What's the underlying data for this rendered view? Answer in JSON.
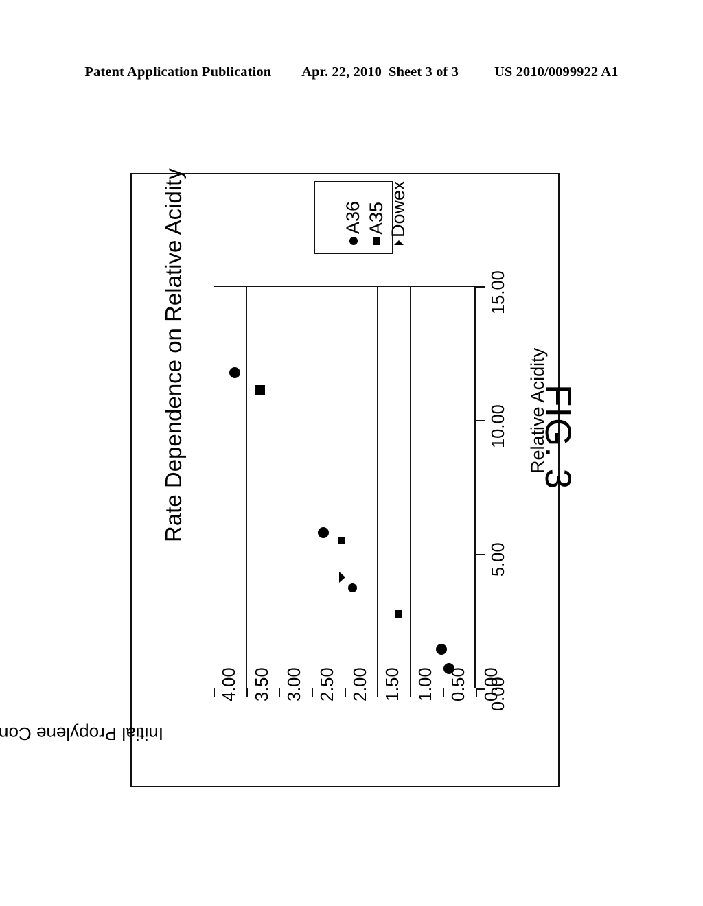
{
  "header": {
    "publication": "Patent Application Publication",
    "date": "Apr. 22, 2010",
    "sheet": "Sheet 3 of 3",
    "doc_number": "US 2010/0099922 A1"
  },
  "figure": {
    "caption": "FIG. 3"
  },
  "legend": {
    "items": [
      {
        "label": "A36",
        "marker": "circle"
      },
      {
        "label": "A35",
        "marker": "square"
      },
      {
        "label": "Dowex",
        "marker": "triangle"
      }
    ]
  },
  "chart_data": {
    "type": "scatter",
    "title": "Rate Dependence on Relative Acidity",
    "xlabel": "Relative Acidity",
    "ylabel": "Initial Propylene Consumption Rate [g / min]",
    "xlim": [
      0.0,
      15.0
    ],
    "ylim": [
      0.0,
      4.0
    ],
    "xticks": [
      "0.00",
      "5.00",
      "10.00",
      "15.00"
    ],
    "yticks": [
      "4.00",
      "3.50",
      "3.00",
      "2.50",
      "2.00",
      "1.50",
      "1.00",
      "0.50",
      "0.00"
    ],
    "grid": true,
    "rotation_deg": 90,
    "legend_position": "top-outside",
    "series": [
      {
        "name": "A36",
        "marker": "circle",
        "points": [
          {
            "x": 11.8,
            "y": 3.69
          },
          {
            "x": 5.8,
            "y": 2.34
          },
          {
            "x": 3.8,
            "y": 1.88
          },
          {
            "x": 1.5,
            "y": 0.53
          },
          {
            "x": 0.8,
            "y": 0.42
          }
        ]
      },
      {
        "name": "A35",
        "marker": "square",
        "points": [
          {
            "x": 11.1,
            "y": 3.3
          },
          {
            "x": 5.5,
            "y": 2.05
          },
          {
            "x": 2.8,
            "y": 1.18
          }
        ]
      },
      {
        "name": "Dowex",
        "marker": "triangle",
        "points": [
          {
            "x": 4.2,
            "y": 2.03
          }
        ]
      }
    ]
  }
}
